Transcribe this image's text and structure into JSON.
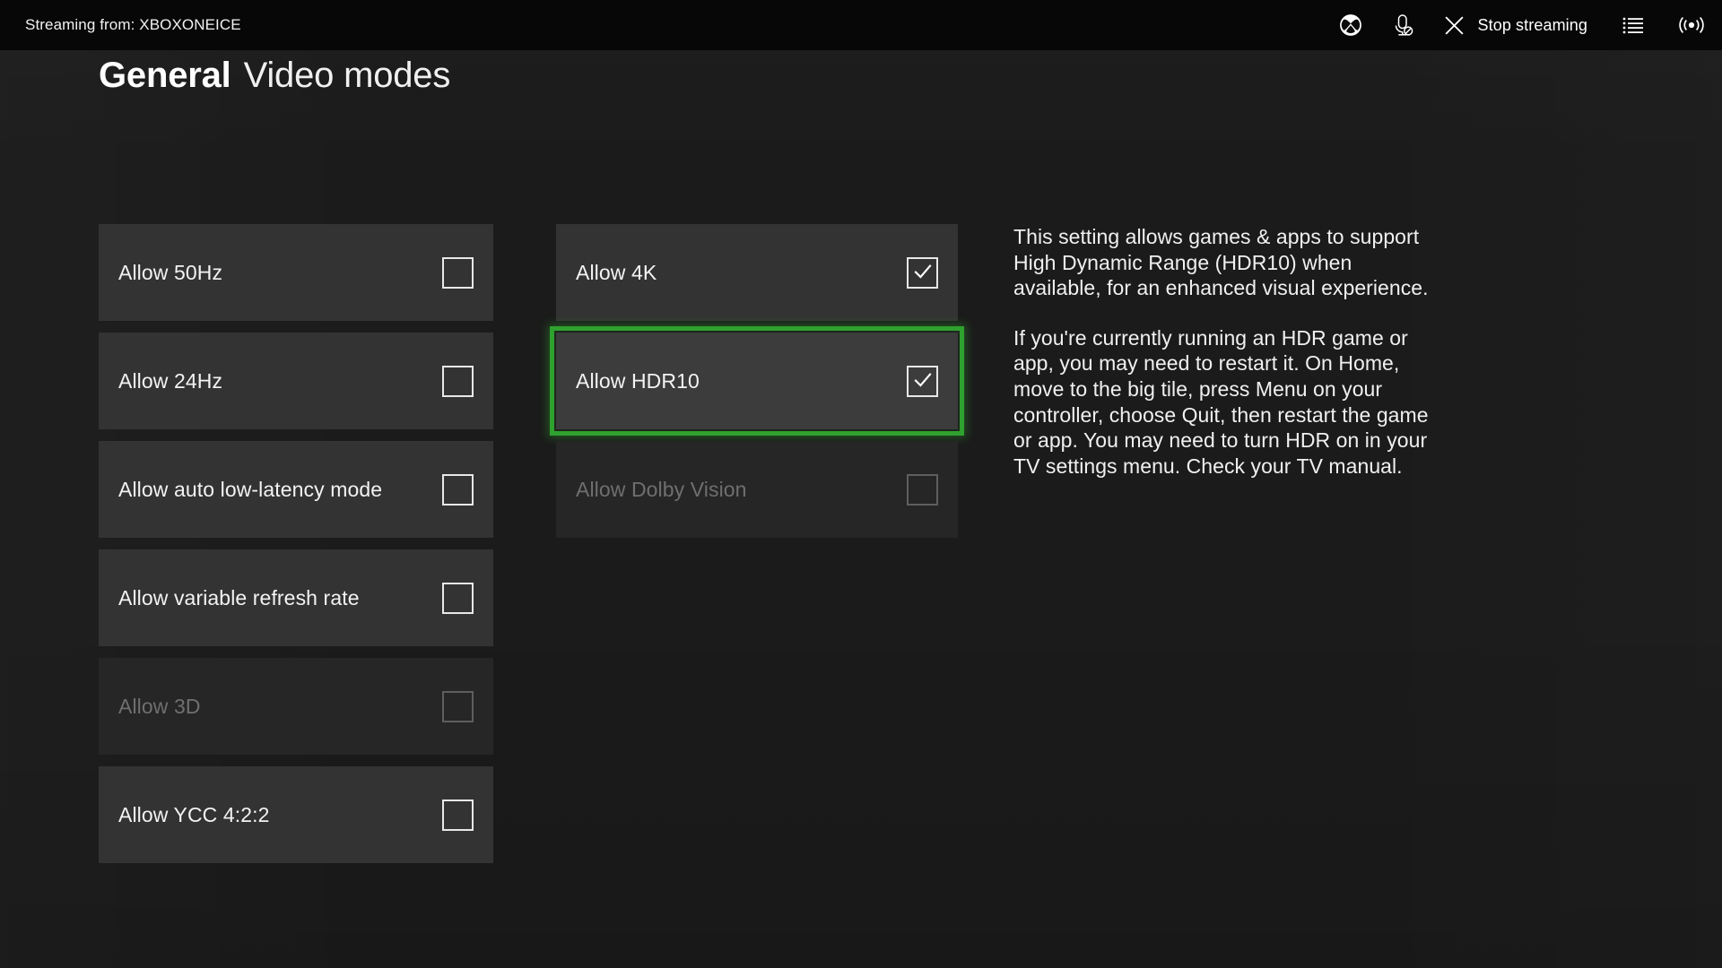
{
  "stream_bar": {
    "source_label": "Streaming from: XBOXONEICE",
    "stop_label": "Stop streaming",
    "icons": {
      "xbox": "xbox-logo-icon",
      "mic": "microphone-muted-icon",
      "close": "close-x-icon",
      "overlay": "list-menu-icon",
      "signal": "connection-signal-icon"
    }
  },
  "title": {
    "section": "General",
    "page": "Video modes"
  },
  "colors": {
    "background": "#1b1b1b",
    "row": "#333333",
    "row_disabled": "#262626",
    "focus_green": "#2fa12f",
    "text": "#f3f3f3",
    "text_disabled": "#6f6f6f",
    "header_bar": "#070707"
  },
  "left_column": [
    {
      "label": "Allow 50Hz",
      "checked": false,
      "disabled": false,
      "focused": false
    },
    {
      "label": "Allow 24Hz",
      "checked": false,
      "disabled": false,
      "focused": false
    },
    {
      "label": "Allow auto low-latency mode",
      "checked": false,
      "disabled": false,
      "focused": false
    },
    {
      "label": "Allow variable refresh rate",
      "checked": false,
      "disabled": false,
      "focused": false
    },
    {
      "label": "Allow 3D",
      "checked": false,
      "disabled": true,
      "focused": false
    },
    {
      "label": "Allow YCC 4:2:2",
      "checked": false,
      "disabled": false,
      "focused": false
    }
  ],
  "middle_column": [
    {
      "label": "Allow 4K",
      "checked": true,
      "disabled": false,
      "focused": false
    },
    {
      "label": "Allow HDR10",
      "checked": true,
      "disabled": false,
      "focused": true
    },
    {
      "label": "Allow Dolby Vision",
      "checked": false,
      "disabled": true,
      "focused": false
    }
  ],
  "description": {
    "paragraphs": [
      "This setting allows games & apps to support High Dynamic Range (HDR10) when available, for an enhanced visual experience.",
      "If you're currently running an HDR game or app, you may need to restart it. On Home, move to the big tile, press Menu on your controller, choose Quit, then restart the game or app. You may need to turn HDR on in your TV settings menu. Check your TV manual."
    ]
  }
}
